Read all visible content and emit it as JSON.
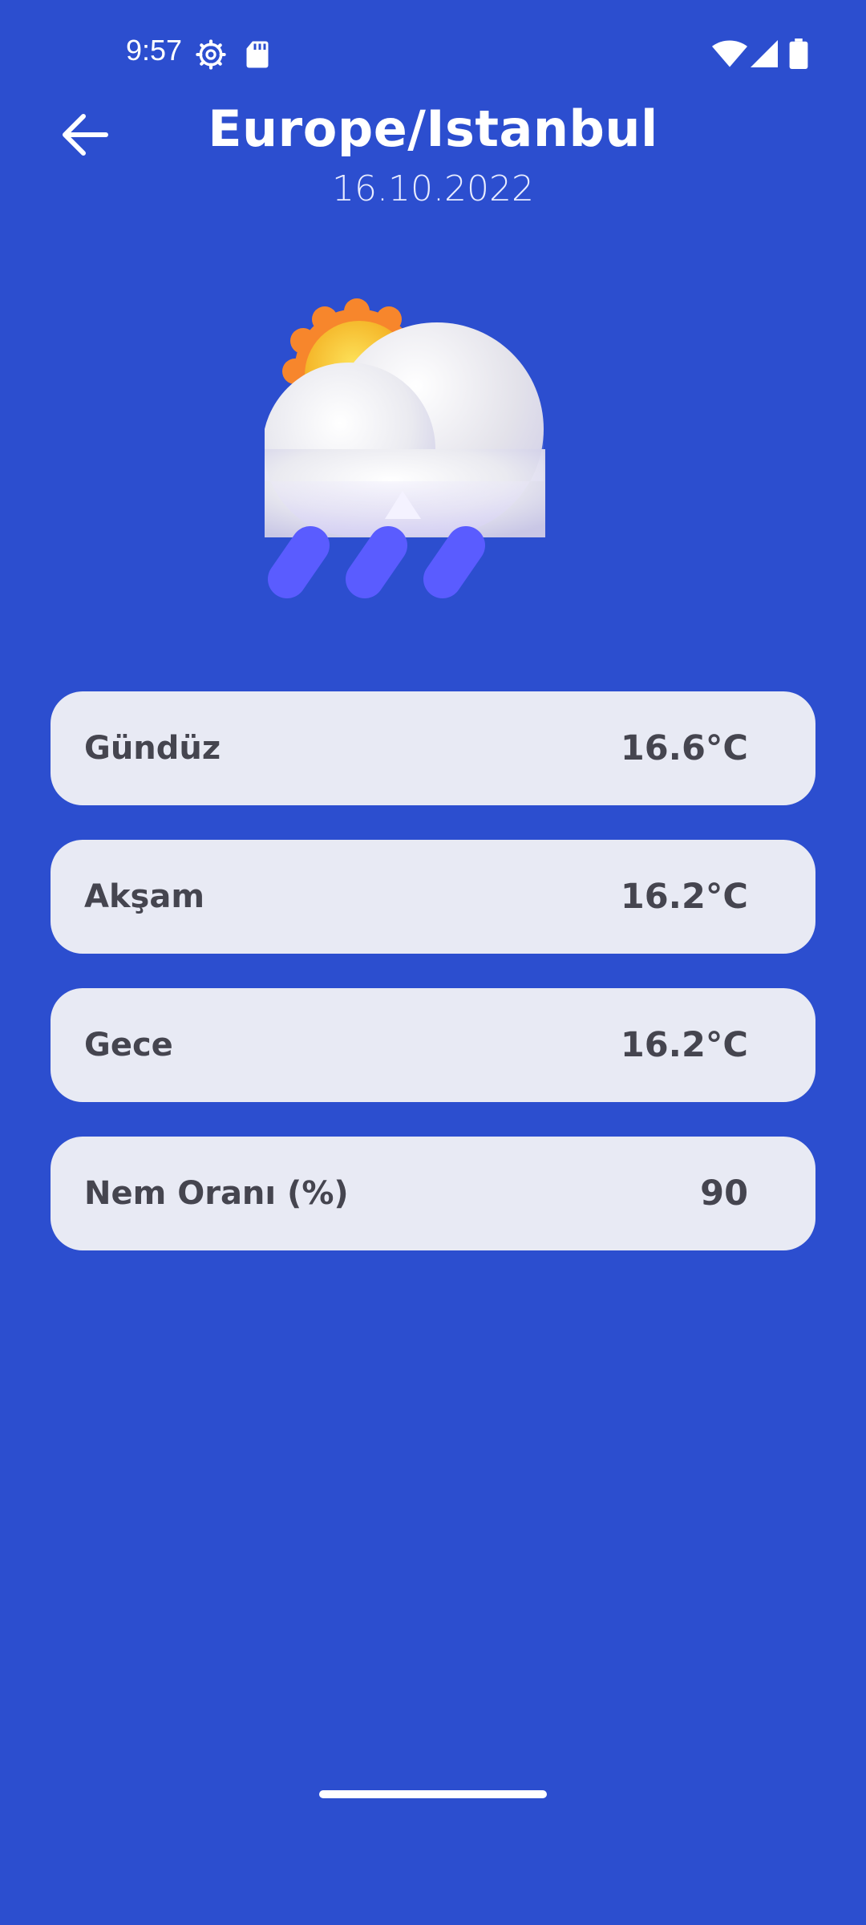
{
  "status_bar": {
    "time": "9:57",
    "icons": [
      "settings-gear-icon",
      "sd-card-icon",
      "wifi-icon",
      "cell-signal-icon",
      "battery-icon"
    ]
  },
  "header": {
    "back_icon": "arrow-left-icon",
    "title": "Europe/Istanbul",
    "date": "16.10.2022"
  },
  "weather_icon": "sun-behind-rain-cloud-icon",
  "cards": [
    {
      "label": "Gündüz",
      "value": "16.6°C"
    },
    {
      "label": "Akşam",
      "value": "16.2°C"
    },
    {
      "label": "Gece",
      "value": "16.2°C"
    },
    {
      "label": "Nem Oranı (%)",
      "value": "90"
    }
  ],
  "colors": {
    "background": "#2c4ecf",
    "card_background": "#e8eaf4",
    "card_text": "#45454f",
    "rain_drops": "#5a5cff",
    "sun": "#f6b82e"
  }
}
